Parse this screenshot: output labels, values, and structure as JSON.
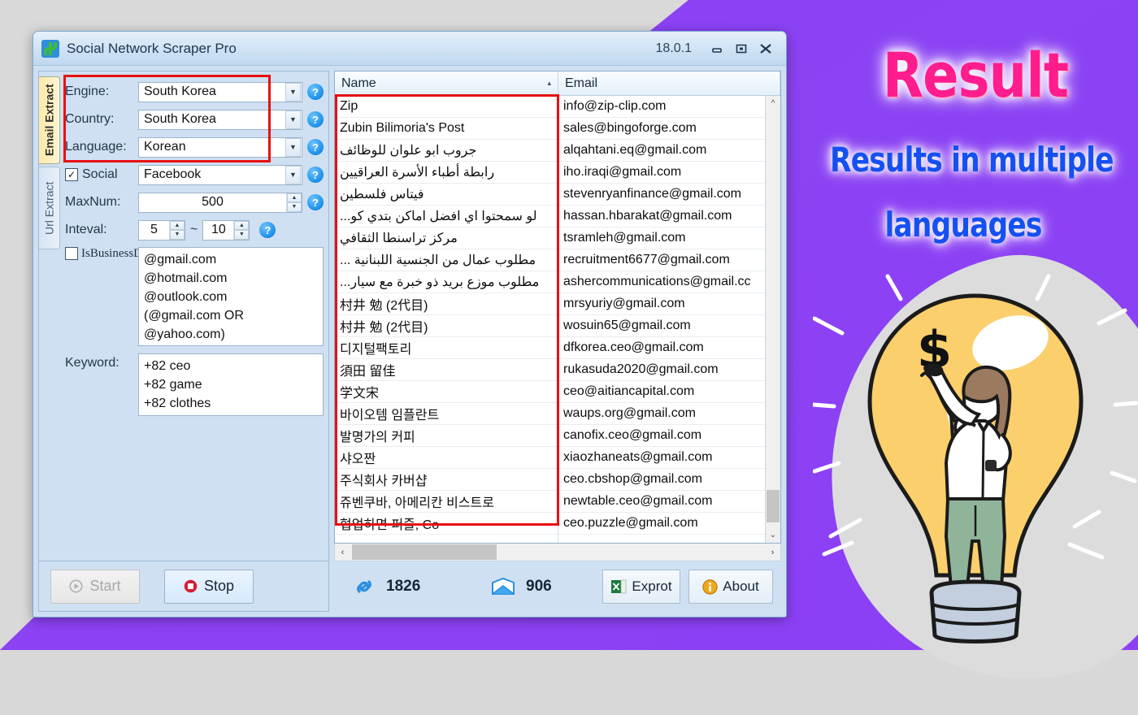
{
  "window": {
    "title": "Social Network Scraper Pro",
    "version": "18.0.1",
    "app_icon": "su-logo-icon",
    "minimize_icon": "minimize-icon",
    "maximize_icon": "maximize-icon",
    "close_icon": "close-icon"
  },
  "tabs": [
    {
      "label": "Email Extract",
      "active": true
    },
    {
      "label": "Url Extract",
      "active": false
    }
  ],
  "form": {
    "engine": {
      "label": "Engine:",
      "value": "South Korea"
    },
    "country": {
      "label": "Country:",
      "value": "South Korea"
    },
    "language": {
      "label": "Language:",
      "value": "Korean"
    },
    "social": {
      "label": "Social",
      "value": "Facebook",
      "checked": true,
      "check_glyph": "✓"
    },
    "maxnum": {
      "label": "MaxNum:",
      "value": "500"
    },
    "interval": {
      "label": "Inteval:",
      "from": "5",
      "to": "10",
      "separator": "~"
    },
    "is_business_domain": {
      "label": "IsBusinessDomain",
      "checked": false
    },
    "domains_text": "@gmail.com\n@hotmail.com\n@outlook.com\n(@gmail.com OR\n@yahoo.com)",
    "keyword": {
      "label": "Keyword:",
      "text": "+82 ceo\n+82 game\n+82 clothes"
    },
    "help_glyph": "?"
  },
  "buttons": {
    "start": {
      "label": "Start",
      "icon": "play-icon",
      "disabled": true
    },
    "stop": {
      "label": "Stop",
      "icon": "stop-icon",
      "disabled": false
    },
    "export": {
      "label": "Exprot",
      "icon": "excel-icon"
    },
    "about": {
      "label": "About",
      "icon": "info-icon"
    }
  },
  "grid": {
    "columns": [
      "Name",
      "Email"
    ],
    "sort_indicator": "▴",
    "rows": [
      {
        "name": "Zip",
        "email": "info@zip-clip.com",
        "rtl": false
      },
      {
        "name": "Zubin Bilimoria's Post",
        "email": "sales@bingoforge.com",
        "rtl": false
      },
      {
        "name": "جروب ابو علوان للوظائف",
        "email": "alqahtani.eq@gmail.com",
        "rtl": true
      },
      {
        "name": "رابطة أطباء الأسرة العراقيين",
        "email": "iho.iraqi@gmail.com",
        "rtl": true
      },
      {
        "name": "فيتاس فلسطين",
        "email": "stevenryanfinance@gmail.com",
        "rtl": true
      },
      {
        "name": "لو سمحتوا اي افضل اماكن بتدي كو...",
        "email": "hassan.hbarakat@gmail.com",
        "rtl": true
      },
      {
        "name": "مركز تراسنطا الثقافي",
        "email": "tsramleh@gmail.com",
        "rtl": true
      },
      {
        "name": "مطلوب عمال من الجنسية اللبنانية ...",
        "email": "recruitment6677@gmail.com",
        "rtl": true
      },
      {
        "name": "مطلوب موزع بريد ذو خبرة مع سيار...",
        "email": "ashercommunications@gmail.cc",
        "rtl": true
      },
      {
        "name": "村井 勉 (2代目)",
        "email": "mrsyuriy@gmail.com",
        "rtl": false
      },
      {
        "name": "村井 勉 (2代目)",
        "email": "wosuin65@gmail.com",
        "rtl": false
      },
      {
        "name": "디지털팩토리",
        "email": "dfkorea.ceo@gmail.com",
        "rtl": false
      },
      {
        "name": "須田 留佳",
        "email": "rukasuda2020@gmail.com",
        "rtl": false
      },
      {
        "name": "学文宋",
        "email": "ceo@aitiancapital.com",
        "rtl": false
      },
      {
        "name": "바이오템 임플란트",
        "email": "waups.org@gmail.com",
        "rtl": false
      },
      {
        "name": "발명가의 커피",
        "email": "canofix.ceo@gmail.com",
        "rtl": false
      },
      {
        "name": "샤오짠",
        "email": "xiaozhaneats@gmail.com",
        "rtl": false
      },
      {
        "name": "주식회사 카버샵",
        "email": "ceo.cbshop@gmail.com",
        "rtl": false
      },
      {
        "name": "쥬벤쿠바, 아메리칸 비스트로",
        "email": "newtable.ceo@gmail.com",
        "rtl": false
      },
      {
        "name": "협업하면 퍼즐, Co",
        "email": "ceo.puzzle@gmail.com",
        "rtl": false
      }
    ]
  },
  "status": {
    "links_count": "1826",
    "links_icon": "link-icon",
    "emails_count": "906",
    "emails_icon": "envelope-icon"
  },
  "promo": {
    "title": "Result",
    "line1": "Results in multiple",
    "line2": "languages",
    "title_color": "#ff1d8e",
    "sub_color": "#1550f0",
    "background_color": "#8b3ff5"
  },
  "illustration": {
    "name": "lightbulb-woman-dollar-illustration",
    "dollar_symbol": "$",
    "bulb_color": "#fbcf6b",
    "pants_color": "#8fb49a",
    "base_color": "#c3cede"
  }
}
